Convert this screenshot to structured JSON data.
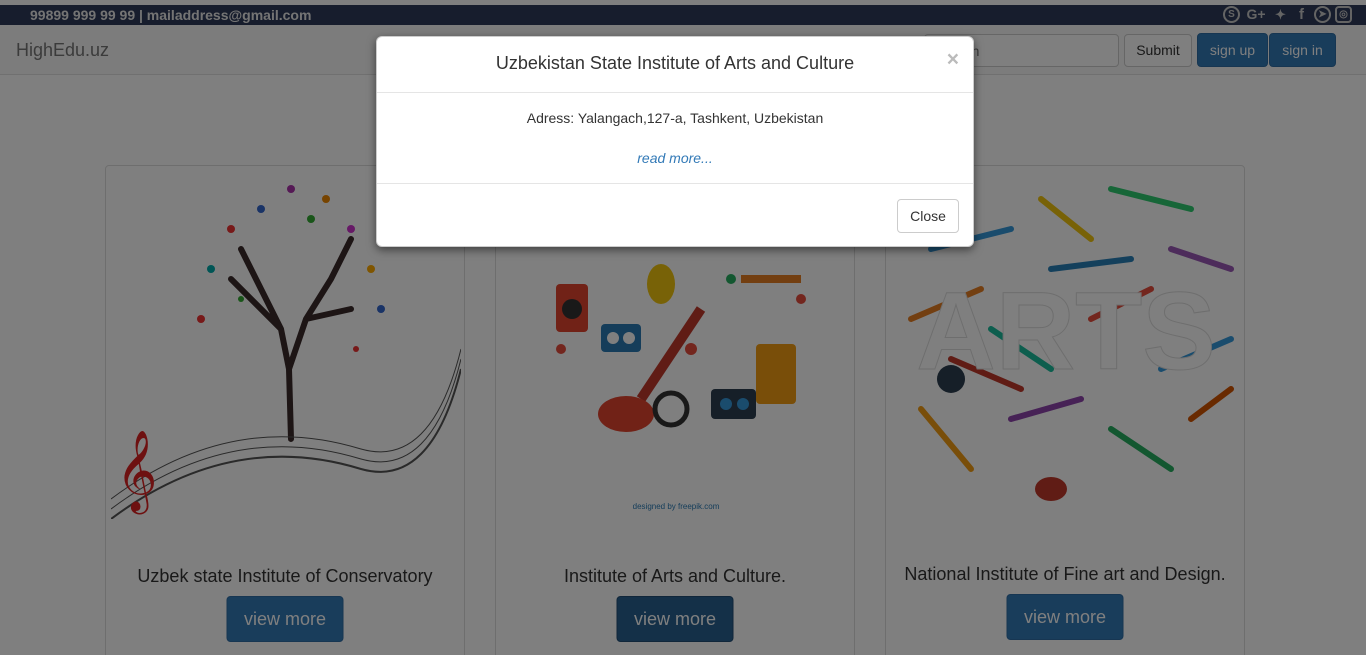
{
  "contact": {
    "text": "99899 999 99 99 | mailaddress@gmail.com"
  },
  "social_icons": [
    "skype-icon",
    "google-plus-icon",
    "twitter-icon",
    "facebook-icon",
    "telegram-icon",
    "instagram-icon"
  ],
  "nav": {
    "brand": "HighEdu.uz",
    "search_placeholder": "Search",
    "submit_label": "Submit",
    "signup_label": "sign up",
    "signin_label": "sign in"
  },
  "cards": [
    {
      "title": "Uzbek state Institute of Conservatory",
      "button": "view more"
    },
    {
      "title": "Institute of Arts and Culture.",
      "button": "view more",
      "image_caption": "designed by freepik.com"
    },
    {
      "title": "National Institute of Fine art and Design.",
      "button": "view more",
      "image_text": "ARTS"
    }
  ],
  "modal": {
    "title": "Uzbekistan State Institute of Arts and Culture",
    "close_x": "×",
    "address": "Adress: Yalangach,127-a, Tashkent, Uzbekistan",
    "read_more": "read more...",
    "close_label": "Close"
  },
  "colors": {
    "primary": "#337ab7",
    "contact_bar": "#2e3b5a",
    "navbar": "#f8f8f8"
  }
}
